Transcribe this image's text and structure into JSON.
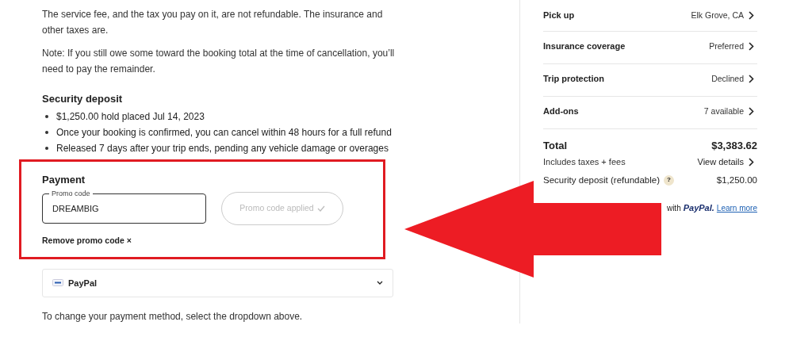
{
  "policy": {
    "paragraphs": [
      "The service fee, and the tax you pay on it, are not refundable. The insurance and other taxes are.",
      "Note: If you still owe some toward the booking total at the time of cancellation, you’ll need to pay the remainder."
    ]
  },
  "security_deposit": {
    "title": "Security deposit",
    "bullets": [
      "$1,250.00 hold placed Jul 14, 2023",
      "Once your booking is confirmed, you can cancel within 48 hours for a full refund",
      "Released 7 days after your trip ends, pending any vehicle damage or overages"
    ]
  },
  "payment": {
    "title": "Payment",
    "highlighted": true,
    "promo_field": {
      "label": "Promo code",
      "value": "DREAMBIG"
    },
    "apply_button": {
      "label": "Promo code applied",
      "disabled": true
    },
    "remove_link": "Remove promo code ×",
    "method": {
      "label": "PayPal",
      "expanded": false
    },
    "helper": "To change your payment method, select the dropdown above."
  },
  "summary": {
    "rows": [
      {
        "label": "Pick up",
        "value": "Elk Grove, CA"
      },
      {
        "label": "Insurance coverage",
        "value": "Preferred"
      },
      {
        "label": "Trip protection",
        "value": "Declined"
      },
      {
        "label": "Add-ons",
        "value": "7 available"
      }
    ],
    "total_label": "Total",
    "total": "$3,383.62",
    "includes": "Includes taxes + fees",
    "view_details": "View details",
    "deposit_label": "Security deposit (refundable)",
    "deposit_help": "?",
    "deposit": "$1,250.00",
    "paypal_note": {
      "prefix": "with",
      "brand": "PayPal",
      "suffix": ".",
      "link": "Learn more"
    }
  },
  "annotation": {
    "arrow": true
  }
}
